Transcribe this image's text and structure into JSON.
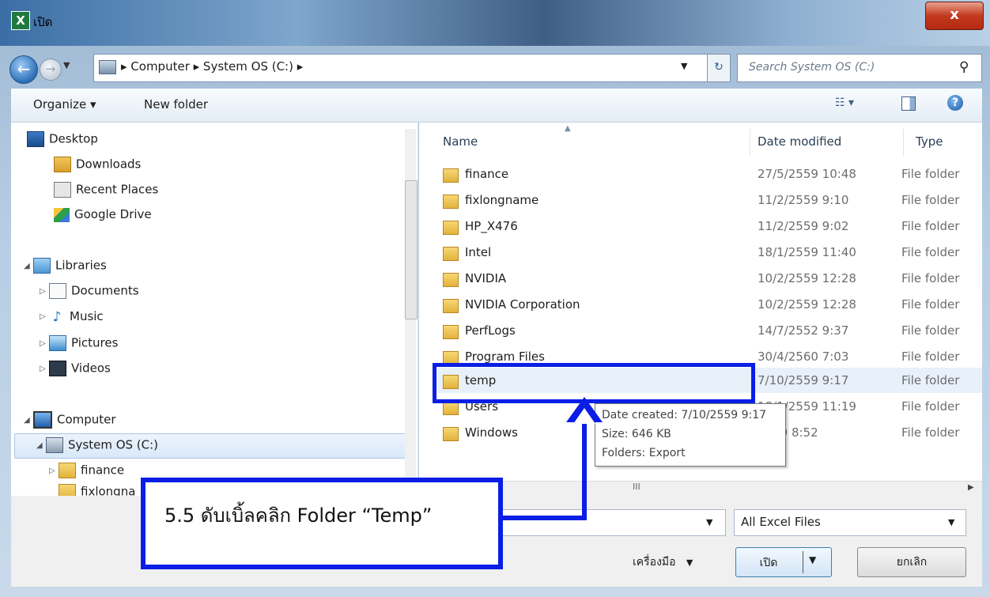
{
  "window": {
    "title": "เปิด",
    "icon_label": "X",
    "close_label": "x"
  },
  "address": {
    "crumbs": "▸ Computer ▸ System OS (C:) ▸",
    "search_placeholder": "Search System OS (C:)"
  },
  "toolbar": {
    "organize": "Organize ▾",
    "new_folder": "New folder"
  },
  "nav": {
    "desktop": "Desktop",
    "downloads": "Downloads",
    "recent": "Recent Places",
    "gdrive": "Google Drive",
    "libraries": "Libraries",
    "documents": "Documents",
    "music": "Music",
    "pictures": "Pictures",
    "videos": "Videos",
    "computer": "Computer",
    "system_os": "System OS (C:)",
    "finance": "finance",
    "fixlongname": "fixlongna"
  },
  "columns": {
    "name": "Name",
    "date": "Date modified",
    "type": "Type"
  },
  "files": [
    {
      "name": "finance",
      "date": "27/5/2559 10:48",
      "type": "File folder"
    },
    {
      "name": "fixlongname",
      "date": "11/2/2559 9:10",
      "type": "File folder"
    },
    {
      "name": "HP_X476",
      "date": "11/2/2559 9:02",
      "type": "File folder"
    },
    {
      "name": "Intel",
      "date": "18/1/2559 11:40",
      "type": "File folder"
    },
    {
      "name": "NVIDIA",
      "date": "10/2/2559 12:28",
      "type": "File folder"
    },
    {
      "name": "NVIDIA Corporation",
      "date": "10/2/2559 12:28",
      "type": "File folder"
    },
    {
      "name": "PerfLogs",
      "date": "14/7/2552 9:37",
      "type": "File folder"
    },
    {
      "name": "Program Files",
      "date": "30/4/2560 7:03",
      "type": "File folder"
    },
    {
      "name": "temp",
      "date": "7/10/2559 9:17",
      "type": "File folder"
    },
    {
      "name": "Users",
      "date": "18/1/2559 11:19",
      "type": "File folder"
    },
    {
      "name": "Windows",
      "date": "2559 8:52",
      "type": "File folder"
    }
  ],
  "tooltip": {
    "created": "Date created: 7/10/2559 9:17",
    "size": "Size: 646 KB",
    "folders": "Folders: Export"
  },
  "bottom": {
    "filetype": "All Excel Files",
    "tools": "เครื่องมือ",
    "open": "เปิด",
    "cancel": "ยกเลิก"
  },
  "annotation": {
    "callout": "5.5 ดับเบิ้ลคลิก Folder “Temp”"
  },
  "colors": {
    "annotation_blue": "#0a1ee6"
  }
}
